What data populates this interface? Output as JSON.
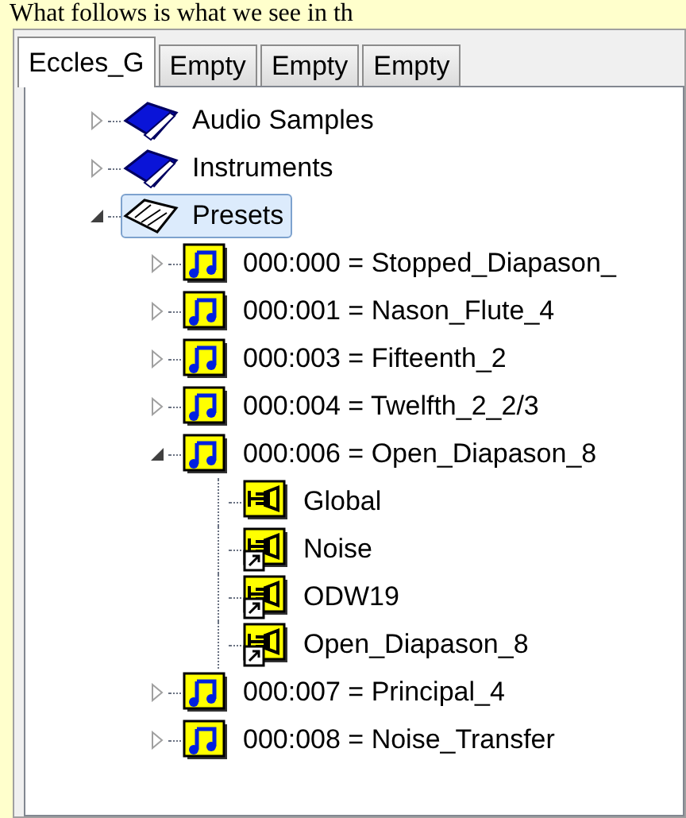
{
  "caption": "What follows is what we see in th",
  "tabs": [
    {
      "label": "Eccles_G",
      "selected": true
    },
    {
      "label": "Empty",
      "selected": false
    },
    {
      "label": "Empty",
      "selected": false
    },
    {
      "label": "Empty",
      "selected": false
    }
  ],
  "tree": [
    {
      "label": "Audio Samples",
      "kind": "book",
      "expanded": false,
      "selected": false
    },
    {
      "label": "Instruments",
      "kind": "book",
      "expanded": false,
      "selected": false
    },
    {
      "label": "Presets",
      "kind": "open-book",
      "expanded": true,
      "selected": true,
      "children": [
        {
          "label": "000:000 = Stopped_Diapason_",
          "kind": "preset",
          "expanded": false,
          "selected": false
        },
        {
          "label": "000:001 = Nason_Flute_4",
          "kind": "preset",
          "expanded": false,
          "selected": false
        },
        {
          "label": "000:003 = Fifteenth_2",
          "kind": "preset",
          "expanded": false,
          "selected": false
        },
        {
          "label": "000:004 = Twelfth_2_2/3",
          "kind": "preset",
          "expanded": false,
          "selected": false
        },
        {
          "label": "000:006 = Open_Diapason_8",
          "kind": "preset",
          "expanded": true,
          "selected": false,
          "children": [
            {
              "label": "Global",
              "kind": "instrument",
              "linked": false,
              "selected": false
            },
            {
              "label": "Noise",
              "kind": "instrument",
              "linked": true,
              "selected": false
            },
            {
              "label": "ODW19",
              "kind": "instrument",
              "linked": true,
              "selected": false
            },
            {
              "label": "Open_Diapason_8",
              "kind": "instrument",
              "linked": true,
              "selected": false
            }
          ]
        },
        {
          "label": "000:007 = Principal_4",
          "kind": "preset",
          "expanded": false,
          "selected": false
        },
        {
          "label": "000:008 = Noise_Transfer",
          "kind": "preset",
          "expanded": false,
          "selected": false
        }
      ]
    }
  ]
}
